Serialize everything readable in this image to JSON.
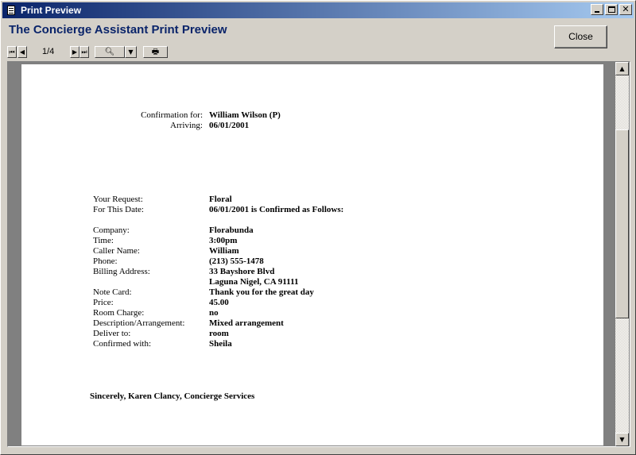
{
  "window": {
    "title": "Print Preview"
  },
  "app": {
    "heading": "The Concierge Assistant Print Preview",
    "close_label": "Close"
  },
  "toolbar": {
    "page_indicator": "1/4",
    "buttons": [
      "first-page",
      "previous-page",
      "next-page",
      "last-page",
      "zoom",
      "zoom-dropdown",
      "print"
    ]
  },
  "doc": {
    "header": [
      {
        "label": "Confirmation for:",
        "value": "William Wilson (P)"
      },
      {
        "label": "Arriving:",
        "value": "06/01/2001"
      }
    ],
    "request": [
      {
        "label": "Your Request:",
        "value": "Floral"
      },
      {
        "label": "For This Date:",
        "value": "06/01/2001 is Confirmed as Follows:"
      }
    ],
    "details": [
      {
        "label": "Company:",
        "value": "Florabunda"
      },
      {
        "label": "Time:",
        "value": "3:00pm"
      },
      {
        "label": "Caller Name:",
        "value": "William"
      },
      {
        "label": "Phone:",
        "value": "(213) 555-1478"
      },
      {
        "label": "Billing Address:",
        "value": "33 Bayshore Blvd"
      },
      {
        "label": "",
        "value": "Laguna Nigel, CA  91111"
      },
      {
        "label": "Note Card:",
        "value": "Thank  you for the great day"
      },
      {
        "label": "Price:",
        "value": "45.00"
      },
      {
        "label": "Room Charge:",
        "value": "no"
      },
      {
        "label": "Description/Arrangement:",
        "value": "Mixed arrangement"
      },
      {
        "label": "Deliver to:",
        "value": "room"
      },
      {
        "label": "Confirmed with:",
        "value": "Sheila"
      }
    ],
    "signature": "Sincerely, Karen Clancy, Concierge Services"
  }
}
